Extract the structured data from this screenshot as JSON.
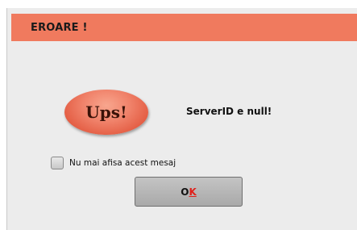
{
  "dialog": {
    "title": "EROARE !",
    "icon_text": "Ups!",
    "message": "ServerID e null!",
    "checkbox": {
      "label": "Nu mai afisa acest mesaj",
      "checked": false
    },
    "ok_button": {
      "label_main": "O",
      "label_accel": "K"
    }
  },
  "colors": {
    "title_bar": "#f07a5e",
    "dialog_bg": "#ececec",
    "badge": "#e8694f",
    "accel_letter": "#e0201a"
  }
}
